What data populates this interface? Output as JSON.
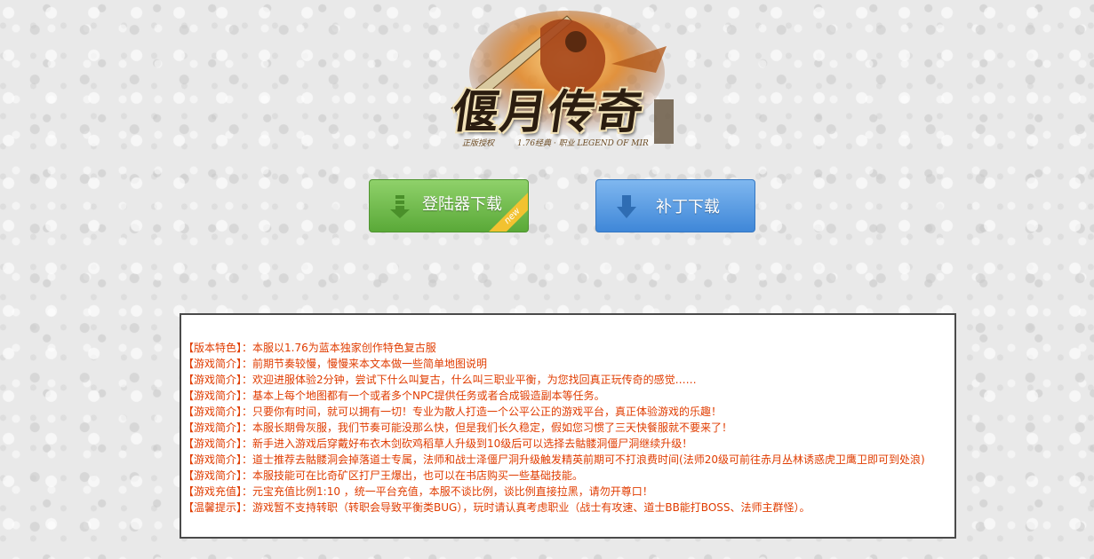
{
  "logo": {
    "title": "偃月传奇",
    "sub_left": "正版授权",
    "sub_right": "1.76经典 · 职业 LEGEND OF MIR"
  },
  "buttons": {
    "launcher_download": "登陆器下载",
    "new_badge": "new",
    "patch_download": "补丁下载"
  },
  "colors": {
    "tag_text": "#e03c00",
    "green_button": "#5aa938",
    "blue_button": "#3f87d8",
    "new_badge": "#f2c230"
  },
  "info": {
    "lines": [
      {
        "tag": "【版本特色】：",
        "text": "本服以1.76为蓝本独家创作特色复古服"
      },
      {
        "tag": "【游戏简介】：",
        "text": "前期节奏较慢，慢慢来本文本做一些简单地图说明"
      },
      {
        "tag": "【游戏简介】：",
        "text": "欢迎进服体验2分钟，尝试下什么叫复古，什么叫三职业平衡，为您找回真正玩传奇的感觉……"
      },
      {
        "tag": "【游戏简介】：",
        "text": "基本上每个地图都有一个或者多个NPC提供任务或者合成锻造副本等任务。"
      },
      {
        "tag": "【游戏简介】：",
        "text": "只要你有时间，就可以拥有一切！专业为散人打造一个公平公正的游戏平台，真正体验游戏的乐趣！"
      },
      {
        "tag": "【游戏简介】：",
        "text": "本服长期骨灰服，我们节奏可能没那么快，但是我们长久稳定，假如您习惯了三天快餐服就不要来了！"
      },
      {
        "tag": "【游戏简介】：",
        "text": "新手进入游戏后穿戴好布衣木剑砍鸡稻草人升级到10级后可以选择去骷髅洞僵尸洞继续升级！"
      },
      {
        "tag": "【游戏简介】：",
        "text": "道士推荐去骷髅洞会掉落道士专属，法师和战士泽僵尸洞升级触发精英前期可不打浪费时间(法师20级可前往赤月丛林诱惑虎卫鹰卫即可到处浪)"
      },
      {
        "tag": "【游戏简介】：",
        "text": "本服技能可在比奇矿区打尸王爆出，也可以在书店购买一些基础技能。"
      },
      {
        "tag": "【游戏充值】：",
        "text": "元宝充值比例1:10 ，统一平台充值，本服不谈比例，谈比例直接拉黑，请勿开尊口！"
      },
      {
        "tag": "【温馨提示】：",
        "text": "游戏暂不支持转职（转职会导致平衡类BUG），玩时请认真考虑职业（战士有攻速、道士BB能打BOSS、法师主群怪）。"
      }
    ]
  }
}
